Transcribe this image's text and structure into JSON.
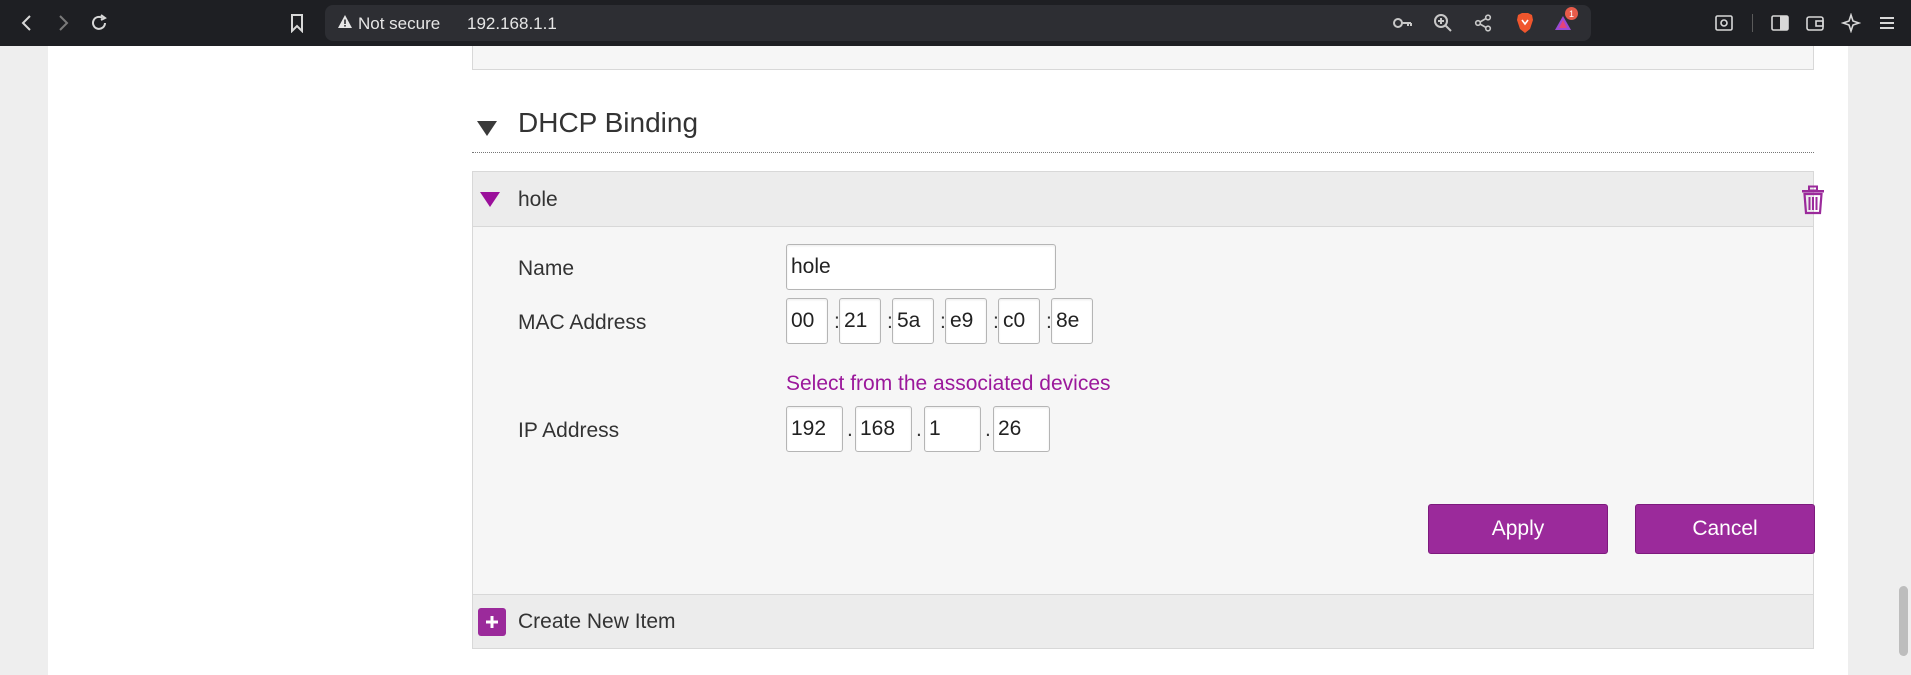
{
  "browser": {
    "security_label": "Not secure",
    "url": "192.168.1.1",
    "notification_count": "1",
    "icons": [
      "back-icon",
      "forward-icon",
      "reload-icon",
      "bookmark-icon",
      "warning-icon",
      "key-icon",
      "zoom-icon",
      "share-icon",
      "brave-shield-icon",
      "brave-rewards-icon",
      "screenshot-icon",
      "sidebar-icon",
      "wallet-icon",
      "leo-ai-icon",
      "menu-icon"
    ]
  },
  "section": {
    "title": "DHCP Binding"
  },
  "item": {
    "title": "hole",
    "fields": {
      "name_label": "Name",
      "name_value": "hole",
      "mac_label": "MAC Address",
      "mac_octets": [
        "00",
        "21",
        "5a",
        "e9",
        "c0",
        "8e"
      ],
      "mac_separator": ":",
      "select_link": "Select from the associated devices",
      "ip_label": "IP Address",
      "ip_octets": [
        "192",
        "168",
        "1",
        "26"
      ],
      "ip_separator": "."
    },
    "buttons": {
      "apply": "Apply",
      "cancel": "Cancel"
    }
  },
  "create_new": {
    "label": "Create New Item"
  },
  "colors": {
    "accent": "#9b2a9b",
    "link": "#9b189b",
    "browser_bar": "#1e1f23"
  }
}
